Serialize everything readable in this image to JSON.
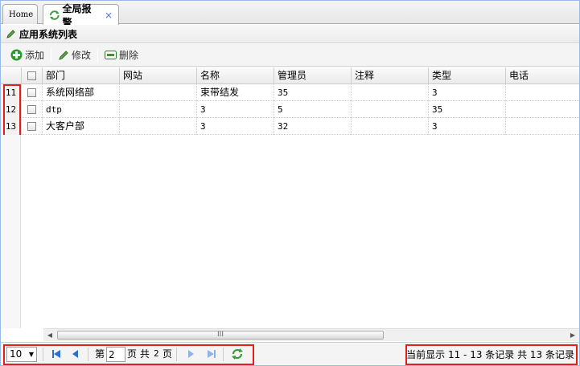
{
  "tabs": [
    {
      "label": "Home"
    },
    {
      "label": "全局报警",
      "close": "×"
    }
  ],
  "panel": {
    "title": "应用系统列表"
  },
  "toolbar": {
    "add": "添加",
    "edit": "修改",
    "delete": "删除"
  },
  "grid": {
    "columns": [
      "部门",
      "网站",
      "名称",
      "管理员",
      "注释",
      "类型",
      "电话"
    ],
    "rows": [
      {
        "num": "11",
        "cells": [
          "系统网络部",
          "",
          "束带结发",
          "35",
          "",
          "3",
          ""
        ]
      },
      {
        "num": "12",
        "cells": [
          "dtp",
          "",
          "3",
          "5",
          "",
          "35",
          ""
        ]
      },
      {
        "num": "13",
        "cells": [
          "大客户部",
          "",
          "3",
          "32",
          "",
          "3",
          ""
        ]
      }
    ]
  },
  "scrollbar": {
    "grip": "III",
    "left_arrow": "◀",
    "right_arrow": "▶"
  },
  "pager": {
    "page_size": "10",
    "page_prefix": "第",
    "current_page": "2",
    "page_suffix": "页 共",
    "total_pages": "2",
    "total_suffix": "页",
    "info": "当前显示 11 - 13 条记录 共 13 条记录"
  },
  "colors": {
    "accent": "#5577cc",
    "highlight": "#e02020",
    "add_green": "#2a9a2a"
  }
}
